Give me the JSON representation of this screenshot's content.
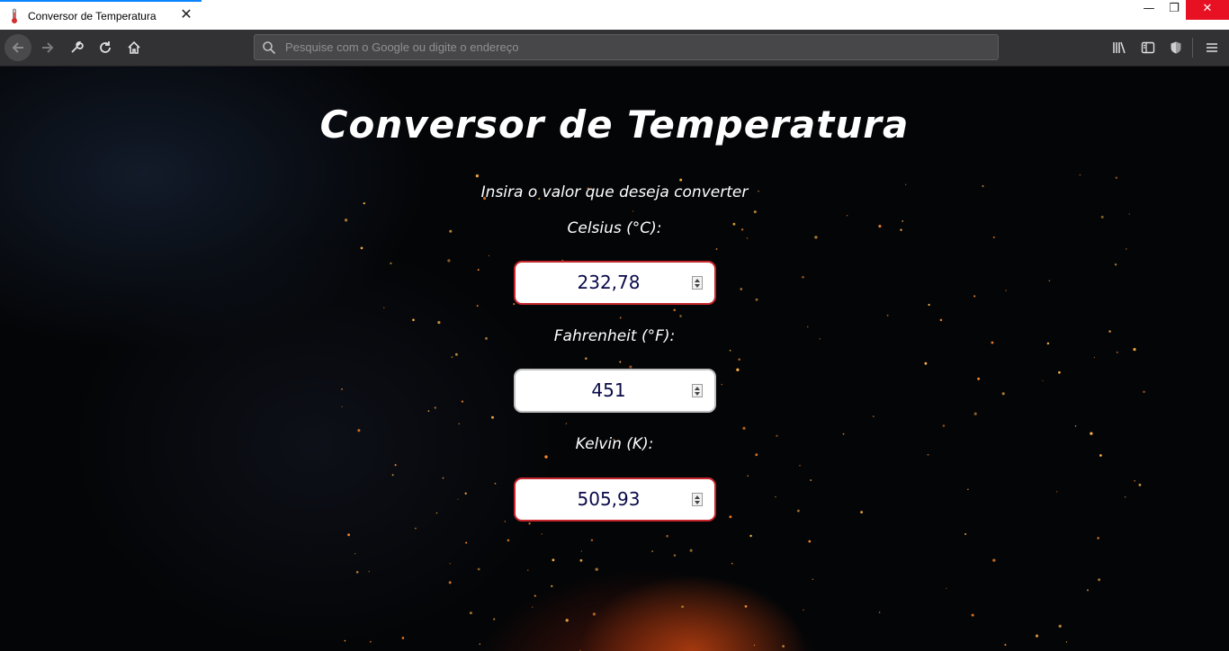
{
  "browser": {
    "tab_title": "Conversor de Temperatura",
    "url_placeholder": "Pesquise com o Google ou digite o endereço"
  },
  "page": {
    "title": "Conversor de Temperatura",
    "instruction": "Insira o valor que deseja converter",
    "fields": [
      {
        "label": "Celsius (°C):",
        "value": "232,78",
        "state": "invalid"
      },
      {
        "label": "Fahrenheit (°F):",
        "value": "451",
        "state": "normal"
      },
      {
        "label": "Kelvin (K):",
        "value": "505,93",
        "state": "invalid"
      }
    ]
  },
  "colors": {
    "invalid_border": "#c7262c",
    "value_text": "#0a0a4a",
    "tab_accent": "#0a84ff"
  },
  "icons": [
    "thermometer-icon",
    "close-icon",
    "back-icon",
    "forward-icon",
    "tools-icon",
    "reload-icon",
    "home-icon",
    "search-icon",
    "library-icon",
    "sidebar-icon",
    "shield-icon",
    "hamburger-menu-icon"
  ]
}
